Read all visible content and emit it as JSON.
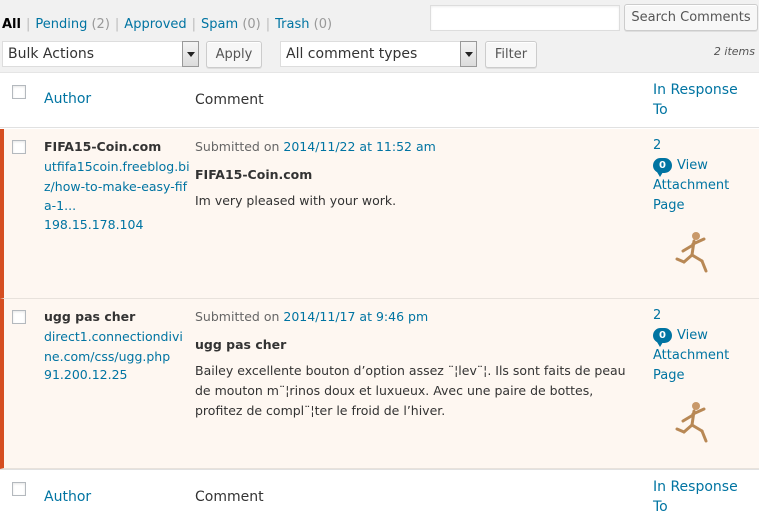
{
  "filters": {
    "all": "All",
    "pending": "Pending",
    "pending_count": "(2)",
    "approved": "Approved",
    "spam": "Spam",
    "spam_count": "(0)",
    "trash": "Trash",
    "trash_count": "(0)",
    "separator": "|"
  },
  "search": {
    "value": "",
    "button": "Search Comments"
  },
  "toolbar": {
    "bulk_actions": "Bulk Actions",
    "apply": "Apply",
    "comment_types": "All comment types",
    "filter": "Filter",
    "items_count": "2 items"
  },
  "columns": {
    "author": "Author",
    "comment": "Comment",
    "in_response_to": "In Response To"
  },
  "comments": [
    {
      "author_name": "FIFA15-Coin.com",
      "author_url": "utfifa15coin.freeblog.biz/how-to-make-easy-fifa-1...",
      "author_ip": "198.15.178.104",
      "submitted_prefix": "Submitted on",
      "submitted_date": "2014/11/22 at 11:52 am",
      "title": "FIFA15-Coin.com",
      "text": "Im very pleased with your work.",
      "response_num": "2",
      "bubble_count": "0",
      "view_label": "View",
      "attachment_page": "Attachment Page"
    },
    {
      "author_name": "ugg pas cher",
      "author_url": "direct1.connectiondivine.com/css/ugg.php",
      "author_ip": "91.200.12.25",
      "submitted_prefix": "Submitted on",
      "submitted_date": "2014/11/17 at 9:46 pm",
      "title": "ugg pas cher",
      "text": "Bailey excellente bouton d’option assez ¨¦lev¨¦. Ils sont faits de peau de mouton m¨¦rinos doux et luxueux. Avec une paire de bottes, profitez de compl¨¦ter le froid de l’hiver.",
      "response_num": "2",
      "bubble_count": "0",
      "view_label": "View",
      "attachment_page": "Attachment Page"
    }
  ],
  "colors": {
    "link": "#0074a2",
    "unapproved_border": "#d54e21",
    "unapproved_bg": "#fef7f1"
  }
}
